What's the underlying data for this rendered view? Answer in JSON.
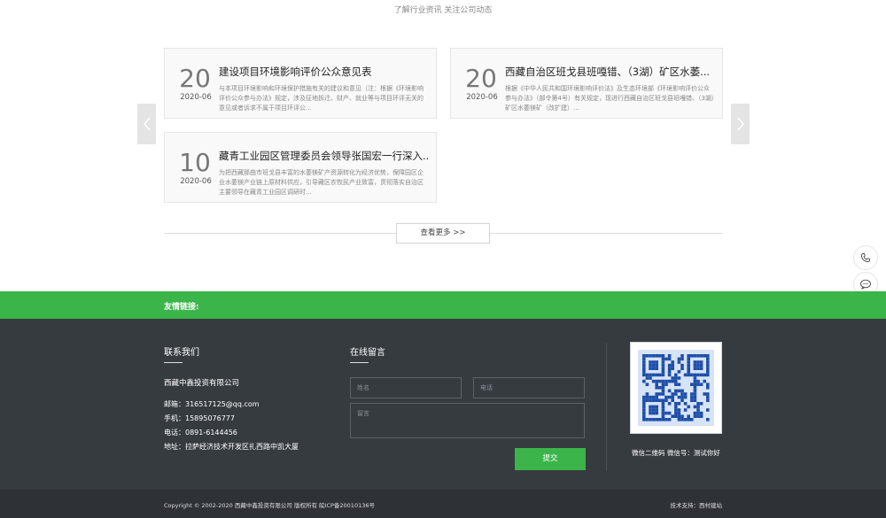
{
  "header": {
    "subtitle": "了解行业资讯 关注公司动态"
  },
  "news": [
    {
      "day": "20",
      "ym": "2020-06",
      "title": "建设项目环境影响评价公众意见表",
      "desc": "与本项目环境影响和环境保护措施有关的建议和意见（注：根据《环境影响评价公众参与办法》规定，涉及征地拆迁、财产、就业等与项目环评无关的意见或者诉求不属于项目环评公..."
    },
    {
      "day": "20",
      "ym": "2020-06",
      "title": "西藏自治区班戈县班嘎错、（3湖）矿区水萎...",
      "desc": "根据《中华人民共和国环境影响评价法》及生态环境部《环境影响评价公众参与办法》（部令第4号）有关规定，现进行西藏自治区班戈县班嘎错、（3湖）矿区水萎镁矿（改扩建）..."
    },
    {
      "day": "10",
      "ym": "2020-06",
      "title": "藏青工业园区管理委员会领导张国宏一行深入...",
      "desc": "为把西藏那曲市班戈县丰富的水萎镁矿产资源转化为经济优势，保障园区企业水萎镁产业链上原材料供应，引导藏区农牧民产业致富，贯彻落实自治区主要领导在藏青工业园区调研时..."
    }
  ],
  "more_label": "查看更多 >>",
  "friend_links_label": "友情链接:",
  "contact": {
    "heading": "联系我们",
    "company": "西藏中鑫投资有限公司",
    "email": "邮箱：316517125@qq.com",
    "mobile": "手机：15895076777",
    "phone": "电话：0891-6144456",
    "address": "地址：拉萨经济技术开发区扎西路中凯大厦"
  },
  "form": {
    "heading": "在线留言",
    "name_placeholder": "姓名",
    "phone_placeholder": "电话",
    "message_placeholder": "留言",
    "submit_label": "提交"
  },
  "qr": {
    "caption": "微信二维码 微信号：测试你好"
  },
  "footer": {
    "copyright": "Copyright © 2002-2020 西藏中鑫投资有限公司 版权所有 皖ICP备20010136号",
    "tech": "技术支持：西村建站"
  },
  "colors": {
    "accent": "#3bb54a",
    "footer_bg": "#363b40",
    "bottom_bg": "#2e3236"
  },
  "side_icons": [
    "phone-icon",
    "chat-icon",
    "qrcode-icon",
    "back-to-top-icon"
  ]
}
